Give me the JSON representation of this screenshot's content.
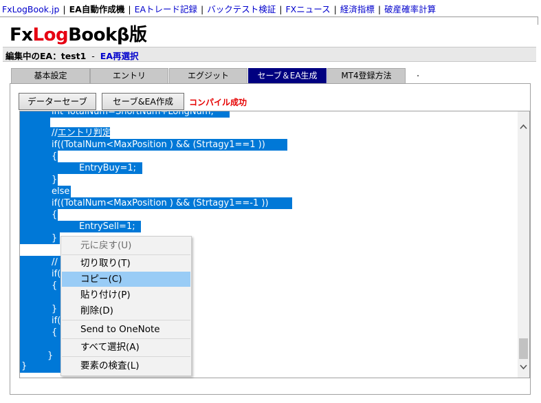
{
  "nav": {
    "home": "FxLogBook.jp",
    "current": "EA自動作成機",
    "trade": "EAトレード記録",
    "backtest": "バックテスト検証",
    "news": "FXニュース",
    "indicators": "経済指標",
    "ruin": "破産確率計算"
  },
  "logo": {
    "part1": "Fx",
    "part2": "Log",
    "part3": "Bookβ版"
  },
  "ea": {
    "label": "編集中のEA：test1",
    "dash": "-",
    "reselect": "EA再選択"
  },
  "tabs": [
    "基本設定",
    "エントリ",
    "エグジット",
    "セーブ＆EA生成",
    "MT4登録方法"
  ],
  "tab_extra": ".",
  "buttons": {
    "save": "データーセーブ",
    "save_create": "セーブ&EA作成"
  },
  "status": "コンパイル成功",
  "code_lines": {
    "l1": "int TotalNum=ShortNum+LongNum;",
    "l2_a": "//",
    "l2_b": "エントリ判定",
    "l3": "if((TotalNum<MaxPosition ) && (Strtagy1==1 ))",
    "l4": "{",
    "l5": "EntryBuy=1;",
    "l6": "}",
    "l7": "else",
    "l8": "if((TotalNum<MaxPosition ) && (Strtagy1==-1 ))",
    "l9": "{",
    "l10": "EntrySell=1;",
    "l11": "}",
    "l12": "//",
    "l13": "if(",
    "l14": "{",
    "l15": "}",
    "l16": "if(",
    "l17": "{",
    "l18": "}",
    "l19": "}"
  },
  "context_menu": {
    "undo": "元に戻す(U)",
    "cut": "切り取り(T)",
    "copy": "コピー(C)",
    "paste": "貼り付け(P)",
    "delete": "削除(D)",
    "onenote": "Send to OneNote",
    "select_all": "すべて選択(A)",
    "inspect": "要素の検査(L)"
  },
  "icons": {
    "scroll_up": "chevron-up-icon",
    "scroll_down": "chevron-down-icon"
  },
  "colors": {
    "selection": "#0078d7",
    "active_tab": "#000080",
    "status": "#e60000",
    "logo_red": "#e60012",
    "menu_hover": "#99ccf6"
  }
}
